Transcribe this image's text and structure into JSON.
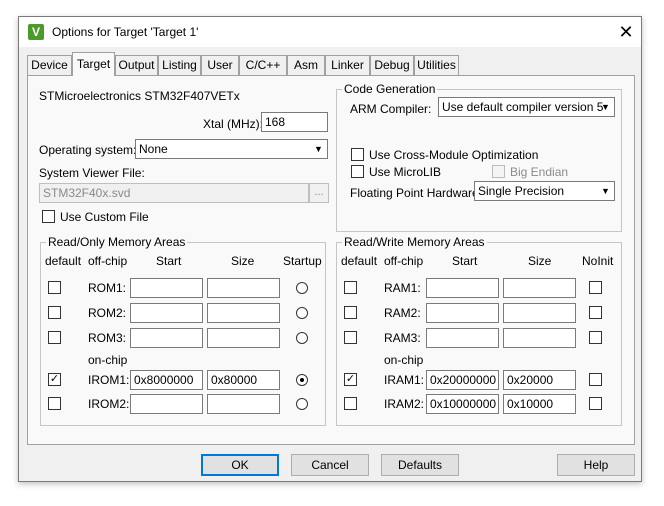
{
  "window": {
    "title": "Options for Target 'Target 1'",
    "icon": "V",
    "close": "✕"
  },
  "tabs": [
    "Device",
    "Target",
    "Output",
    "Listing",
    "User",
    "C/C++",
    "Asm",
    "Linker",
    "Debug",
    "Utilities"
  ],
  "target": {
    "device_name": "STMicroelectronics STM32F407VETx",
    "xtal_label": "Xtal (MHz):",
    "xtal_value": "168",
    "os_label": "Operating system:",
    "os_value": "None",
    "svf_label": "System Viewer File:",
    "svf_value": "STM32F40x.svd",
    "browse": "...",
    "use_custom_file": "Use Custom File"
  },
  "code_gen": {
    "title": "Code Generation",
    "arm_compiler_label": "ARM Compiler:",
    "arm_compiler_value": "Use default compiler version 5",
    "cross_module": "Use Cross-Module Optimization",
    "microlib": "Use MicroLIB",
    "big_endian": "Big Endian",
    "fph_label": "Floating Point Hardware:",
    "fph_value": "Single Precision"
  },
  "rom": {
    "title": "Read/Only Memory Areas",
    "headers": {
      "default": "default",
      "offchip": "off-chip",
      "start": "Start",
      "size": "Size",
      "startup": "Startup"
    },
    "onchip": "on-chip",
    "rows": [
      {
        "label": "ROM1:",
        "start": "",
        "size": "",
        "checked": false,
        "startup": false
      },
      {
        "label": "ROM2:",
        "start": "",
        "size": "",
        "checked": false,
        "startup": false
      },
      {
        "label": "ROM3:",
        "start": "",
        "size": "",
        "checked": false,
        "startup": false
      },
      {
        "label": "IROM1:",
        "start": "0x8000000",
        "size": "0x80000",
        "checked": true,
        "startup": true
      },
      {
        "label": "IROM2:",
        "start": "",
        "size": "",
        "checked": false,
        "startup": false
      }
    ]
  },
  "ram": {
    "title": "Read/Write Memory Areas",
    "headers": {
      "default": "default",
      "offchip": "off-chip",
      "start": "Start",
      "size": "Size",
      "noinit": "NoInit"
    },
    "onchip": "on-chip",
    "rows": [
      {
        "label": "RAM1:",
        "start": "",
        "size": "",
        "checked": false,
        "noinit": false
      },
      {
        "label": "RAM2:",
        "start": "",
        "size": "",
        "checked": false,
        "noinit": false
      },
      {
        "label": "RAM3:",
        "start": "",
        "size": "",
        "checked": false,
        "noinit": false
      },
      {
        "label": "IRAM1:",
        "start": "0x20000000",
        "size": "0x20000",
        "checked": true,
        "noinit": false
      },
      {
        "label": "IRAM2:",
        "start": "0x10000000",
        "size": "0x10000",
        "checked": false,
        "noinit": false
      }
    ]
  },
  "buttons": {
    "ok": "OK",
    "cancel": "Cancel",
    "defaults": "Defaults",
    "help": "Help"
  },
  "colors": {
    "accent": "#0078d7",
    "window_bg": "#f0f0f0",
    "panel_bg": "#f9f9f9"
  }
}
